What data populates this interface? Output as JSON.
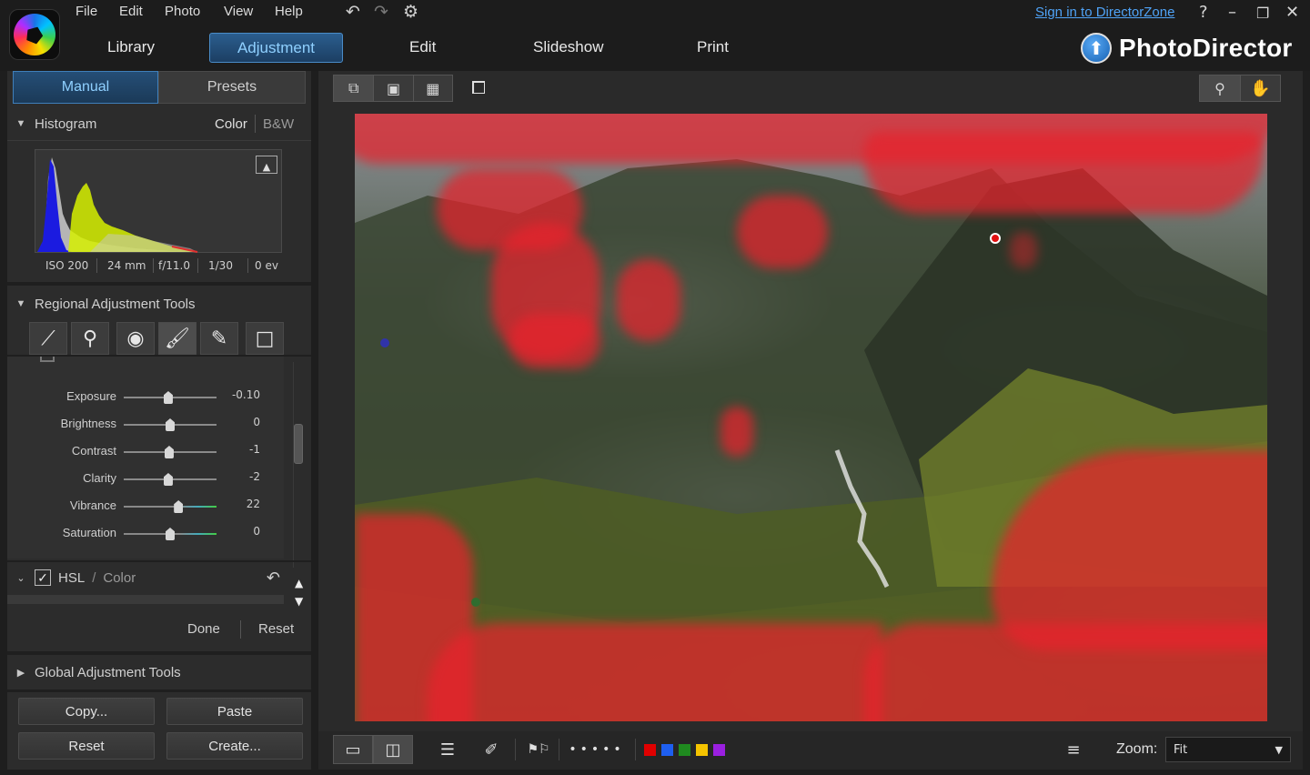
{
  "menu": {
    "file": "File",
    "edit": "Edit",
    "photo": "Photo",
    "view": "View",
    "help": "Help"
  },
  "modes": {
    "library": "Library",
    "adjustment": "Adjustment",
    "edit": "Edit",
    "slideshow": "Slideshow",
    "print": "Print"
  },
  "header": {
    "signin": "Sign in to DirectorZone",
    "help": "?",
    "brand": "PhotoDirector"
  },
  "panel": {
    "tabs": {
      "manual": "Manual",
      "presets": "Presets"
    },
    "histogram": {
      "title": "Histogram",
      "color": "Color",
      "bw": "B&W",
      "exif": {
        "iso": "ISO 200",
        "focal": "24 mm",
        "aperture": "f/11.0",
        "shutter": "1/30",
        "ev": "0 ev"
      }
    },
    "regional": {
      "title": "Regional Adjustment Tools"
    },
    "sliders": [
      {
        "label": "Exposure",
        "value": "-0.10",
        "pos": 0.48
      },
      {
        "label": "Brightness",
        "value": "0",
        "pos": 0.5
      },
      {
        "label": "Contrast",
        "value": "-1",
        "pos": 0.49
      },
      {
        "label": "Clarity",
        "value": "-2",
        "pos": 0.48
      },
      {
        "label": "Vibrance",
        "value": "22",
        "pos": 0.59
      },
      {
        "label": "Saturation",
        "value": "0",
        "pos": 0.5
      }
    ],
    "hsl": {
      "label": "HSL",
      "sep": "/",
      "color": "Color"
    },
    "done": "Done",
    "reset": "Reset",
    "global": {
      "title": "Global Adjustment Tools"
    },
    "buttons": {
      "copy": "Copy...",
      "paste": "Paste",
      "reset": "Reset",
      "create": "Create..."
    }
  },
  "bottom": {
    "zoom_label": "Zoom:",
    "zoom_value": "Fit"
  },
  "colors": {
    "accent": "#4a8cc8",
    "mask": "#e8232d",
    "labels": [
      "#e00000",
      "#1e5ff0",
      "#1f8a1f",
      "#f5c400",
      "#9a1fe0"
    ]
  }
}
